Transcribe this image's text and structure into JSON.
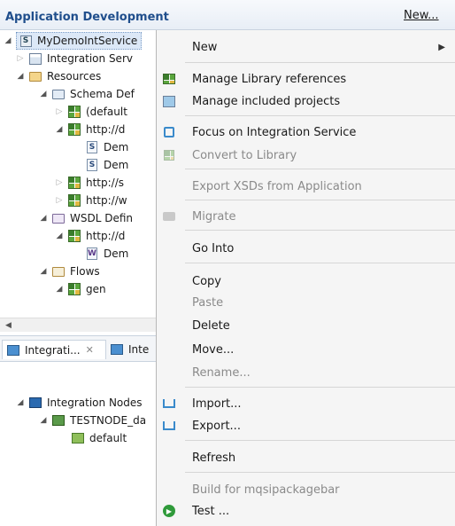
{
  "header": {
    "title": "Application Development",
    "new_link": "New..."
  },
  "tree": {
    "items": [
      {
        "label": "MyDemoIntService",
        "icon": "service-project-icon",
        "arrow": "expanded"
      },
      {
        "label": "Integration Serv",
        "icon": "integration-service-icon",
        "arrow": "collapsed"
      },
      {
        "label": "Resources",
        "icon": "folder-icon",
        "arrow": "expanded"
      },
      {
        "label": "Schema Def",
        "icon": "schema-folder-icon",
        "arrow": "expanded"
      },
      {
        "label": "(default",
        "icon": "namespace-icon",
        "arrow": "collapsed"
      },
      {
        "label": "http://d",
        "icon": "namespace-icon",
        "arrow": "expanded"
      },
      {
        "label": "Dem",
        "icon": "schema-file-icon",
        "arrow": ""
      },
      {
        "label": "Dem",
        "icon": "schema-file-icon",
        "arrow": ""
      },
      {
        "label": "http://s",
        "icon": "namespace-icon",
        "arrow": "collapsed"
      },
      {
        "label": "http://w",
        "icon": "namespace-icon",
        "arrow": "collapsed"
      },
      {
        "label": "WSDL Defin",
        "icon": "wsdl-folder-icon",
        "arrow": "expanded"
      },
      {
        "label": "http://d",
        "icon": "namespace-icon",
        "arrow": "expanded"
      },
      {
        "label": "Dem",
        "icon": "wsdl-file-icon",
        "arrow": ""
      },
      {
        "label": "Flows",
        "icon": "flows-folder-icon",
        "arrow": "expanded"
      },
      {
        "label": "gen",
        "icon": "namespace-icon",
        "arrow": "expanded"
      }
    ]
  },
  "lower_panel": {
    "tab_active": "Integrati...",
    "tab_close": "✕",
    "tab_other": "Inte",
    "tree": [
      {
        "label": "Integration Nodes",
        "icon": "integration-nodes-icon"
      },
      {
        "label": "TESTNODE_da",
        "icon": "node-icon"
      },
      {
        "label": "default",
        "icon": "server-icon"
      }
    ]
  },
  "menu": {
    "items": [
      {
        "label": "New",
        "enabled": true,
        "submenu": true,
        "icon": ""
      },
      {
        "label": "Manage Library references",
        "enabled": true,
        "icon": "library-refs-icon"
      },
      {
        "label": "Manage included projects",
        "enabled": true,
        "icon": "included-projects-icon"
      },
      {
        "label": "Focus on Integration Service",
        "enabled": true,
        "icon": "focus-icon"
      },
      {
        "label": "Convert to Library",
        "enabled": false,
        "icon": "convert-library-icon"
      },
      {
        "label": "Export XSDs from Application",
        "enabled": false,
        "icon": ""
      },
      {
        "label": "Migrate",
        "enabled": false,
        "icon": "migrate-icon"
      },
      {
        "label": "Go Into",
        "enabled": true,
        "icon": ""
      },
      {
        "label": "Copy",
        "enabled": true,
        "icon": ""
      },
      {
        "label": "Paste",
        "enabled": false,
        "icon": ""
      },
      {
        "label": "Delete",
        "enabled": true,
        "icon": ""
      },
      {
        "label": "Move...",
        "enabled": true,
        "icon": ""
      },
      {
        "label": "Rename...",
        "enabled": false,
        "icon": ""
      },
      {
        "label": "Import...",
        "enabled": true,
        "icon": "import-icon"
      },
      {
        "label": "Export...",
        "enabled": true,
        "icon": "export-icon"
      },
      {
        "label": "Refresh",
        "enabled": true,
        "icon": ""
      },
      {
        "label": "Build for mqsipackagebar",
        "enabled": false,
        "icon": ""
      },
      {
        "label": "Test ...",
        "enabled": true,
        "icon": "test-run-icon"
      }
    ]
  },
  "colors": {
    "header_title": "#1f4e8c",
    "menu_background": "#f5f5f5",
    "disabled_text": "#8a8a8a"
  }
}
